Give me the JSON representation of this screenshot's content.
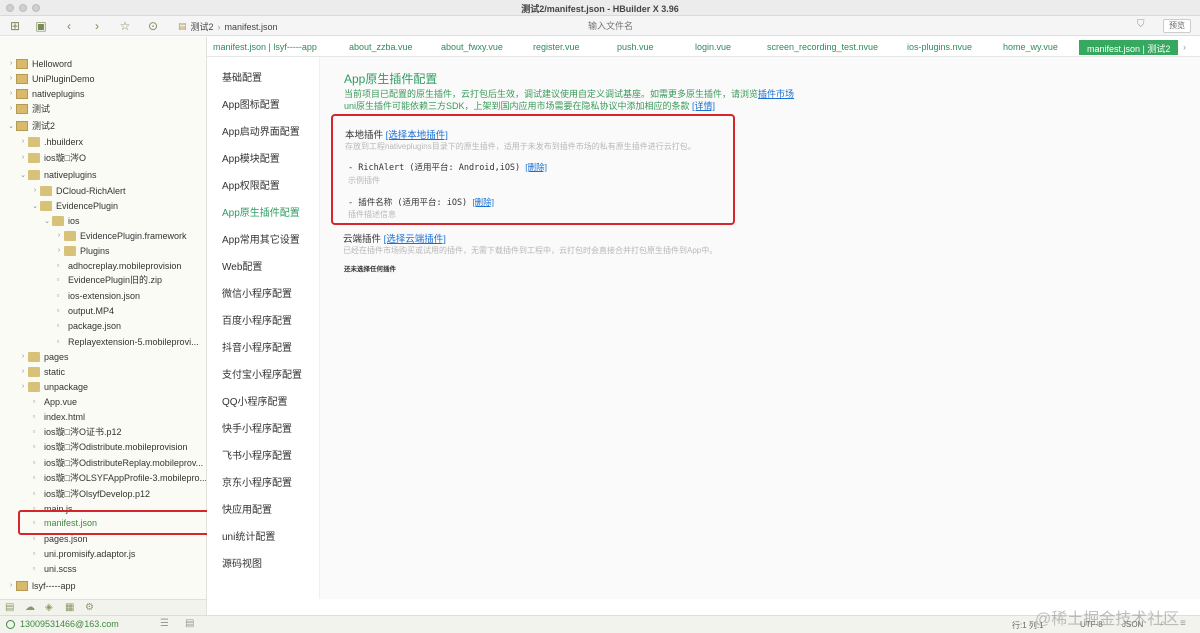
{
  "window": {
    "title": "测试2/manifest.json - HBuilder X 3.96"
  },
  "toolbar": {
    "breadcrumb": [
      "测试2",
      "manifest.json"
    ],
    "file_search_placeholder": "输入文件名",
    "preview_label": "预览"
  },
  "sidebar": {
    "items": [
      {
        "label": "Helloword",
        "type": "project",
        "arrow": "›"
      },
      {
        "label": "UniPluginDemo",
        "type": "project",
        "arrow": "›"
      },
      {
        "label": "nativeplugins",
        "type": "project",
        "arrow": "›"
      },
      {
        "label": "测试",
        "type": "project",
        "arrow": "›"
      },
      {
        "label": "测试2",
        "type": "project",
        "arrow": "⌄"
      },
      {
        "label": ".hbuilderx",
        "type": "folder",
        "arrow": "›"
      },
      {
        "label": "ios璇□涔O",
        "type": "folder",
        "arrow": "›"
      },
      {
        "label": "nativeplugins",
        "type": "folder",
        "arrow": "⌄"
      },
      {
        "label": "DCloud-RichAlert",
        "type": "folder",
        "arrow": "›"
      },
      {
        "label": "EvidencePlugin",
        "type": "folder",
        "arrow": "⌄"
      },
      {
        "label": "ios",
        "type": "folder",
        "arrow": "⌄"
      },
      {
        "label": "EvidencePlugin.framework",
        "type": "folder",
        "arrow": "›"
      },
      {
        "label": "Plugins",
        "type": "folder",
        "arrow": "›"
      },
      {
        "label": "adhocreplay.mobileprovision",
        "type": "file",
        "arrow": ""
      },
      {
        "label": "EvidencePlugin旧的.zip",
        "type": "file",
        "arrow": ""
      },
      {
        "label": "ios-extension.json",
        "type": "file",
        "arrow": ""
      },
      {
        "label": "output.MP4",
        "type": "file",
        "arrow": ""
      },
      {
        "label": "package.json",
        "type": "file",
        "arrow": ""
      },
      {
        "label": "Replayextension-5.mobileprovi...",
        "type": "file",
        "arrow": ""
      },
      {
        "label": "pages",
        "type": "folder",
        "arrow": "›"
      },
      {
        "label": "static",
        "type": "folder",
        "arrow": "›"
      },
      {
        "label": "unpackage",
        "type": "folder",
        "arrow": "›"
      },
      {
        "label": "App.vue",
        "type": "file",
        "arrow": ""
      },
      {
        "label": "index.html",
        "type": "file",
        "arrow": ""
      },
      {
        "label": "ios璇□涔O证书.p12",
        "type": "file",
        "arrow": ""
      },
      {
        "label": "ios璇□涔Odistribute.mobileprovision",
        "type": "file",
        "arrow": ""
      },
      {
        "label": "ios璇□涔OdistributeReplay.mobileprov...",
        "type": "file",
        "arrow": ""
      },
      {
        "label": "ios璇□涔OLSYFAppProfile-3.mobilepro...",
        "type": "file",
        "arrow": ""
      },
      {
        "label": "ios璇□涔OlsyfDevelop.p12",
        "type": "file",
        "arrow": ""
      },
      {
        "label": "main.js",
        "type": "file",
        "arrow": ""
      },
      {
        "label": "manifest.json",
        "type": "file",
        "arrow": ""
      },
      {
        "label": "pages.json",
        "type": "file",
        "arrow": ""
      },
      {
        "label": "uni.promisify.adaptor.js",
        "type": "file",
        "arrow": ""
      },
      {
        "label": "uni.scss",
        "type": "file",
        "arrow": ""
      },
      {
        "label": "lsyf-----app",
        "type": "project",
        "arrow": "›"
      }
    ],
    "selected_index": 30
  },
  "tabs": [
    {
      "label": "manifest.json | lsyf-----app"
    },
    {
      "label": "about_zzba.vue"
    },
    {
      "label": "about_fwxy.vue"
    },
    {
      "label": "register.vue"
    },
    {
      "label": "push.vue"
    },
    {
      "label": "login.vue"
    },
    {
      "label": "screen_recording_test.nvue"
    },
    {
      "label": "ios-plugins.nvue"
    },
    {
      "label": "home_wy.vue"
    },
    {
      "label": "manifest.json | 测试2"
    }
  ],
  "tab_more": "›",
  "settings_nav": [
    "基础配置",
    "App图标配置",
    "App启动界面配置",
    "App模块配置",
    "App权限配置",
    "App原生插件配置",
    "App常用其它设置",
    "Web配置",
    "微信小程序配置",
    "百度小程序配置",
    "抖音小程序配置",
    "支付宝小程序配置",
    "QQ小程序配置",
    "快手小程序配置",
    "飞书小程序配置",
    "京东小程序配置",
    "快应用配置",
    "uni统计配置",
    "源码视图"
  ],
  "settings_nav_active": 5,
  "content": {
    "title": "App原生插件配置",
    "desc1_prefix": "当前项目已配置的原生插件，云打包后生效，调试建议使用自定义调试基座。如需更多原生插件，请浏览",
    "desc1_link": "插件市场",
    "desc2_prefix": "uni原生插件可能依赖三方SDK，上架到国内应用市场需要在隐私协议中添加相应的条款",
    "desc2_link": "[详情]",
    "local": {
      "heading": "本地插件",
      "link": "[选择本地插件]",
      "note": "存放到工程nativeplugins目录下的原生插件，适用于未发布到插件市场的私有原生插件进行云打包。",
      "plugins": [
        {
          "name": "- RichAlert (适用平台: Android,iOS)",
          "delete": "[删除]",
          "desc": "示例插件"
        },
        {
          "name": "- 插件名称 (适用平台: iOS)",
          "delete": "[删除]",
          "desc": "插件描述信息"
        }
      ]
    },
    "cloud": {
      "heading": "云端插件",
      "link": "[选择云端插件]",
      "note": "已经在插件市场购买或试用的插件，无需下载插件到工程中，云打包时会直接合并打包原生插件到App中。",
      "empty": "还未选择任何插件"
    }
  },
  "statusbar": {
    "email": "13009531466@163.com",
    "line_col": "行:1  列:1",
    "encoding": "UTF-8",
    "language": "JSON"
  },
  "watermark": "@稀土掘金技术社区"
}
